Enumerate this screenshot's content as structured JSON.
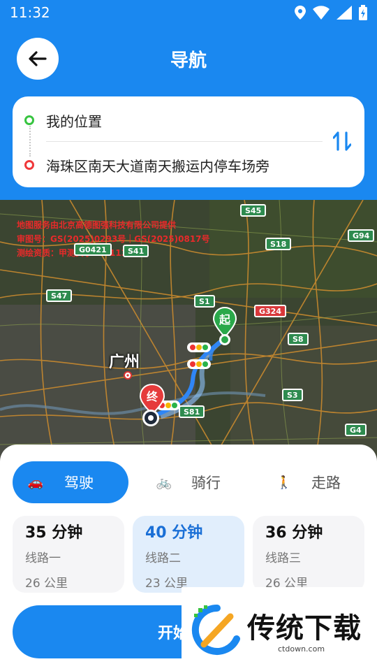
{
  "status_bar": {
    "time": "11:32"
  },
  "header": {
    "title": "导航"
  },
  "route": {
    "from": "我的位置",
    "to": "海珠区南天大道南天搬运内停车场旁"
  },
  "map": {
    "copyright_lines": [
      "地图服务由北京高德图强科技有限公司提供",
      "审图号：GS(2025)0293号｜GS(2025)0817号",
      "测绘资质：甲测资字11111328"
    ],
    "city_label": "广州",
    "start_marker": "起",
    "end_marker": "终",
    "road_badges": [
      "S45",
      "G94",
      "S18",
      "G0421",
      "S41",
      "S47",
      "S1",
      "G324",
      "S8",
      "S3",
      "S81",
      "G4"
    ]
  },
  "modes": [
    {
      "label": "驾驶",
      "icon": "🚗"
    },
    {
      "label": "骑行",
      "icon": "🚲"
    },
    {
      "label": "走路",
      "icon": "🚶"
    }
  ],
  "route_options": [
    {
      "time": "35 分钟",
      "name": "线路一",
      "distance": "26 公里"
    },
    {
      "time": "40 分钟",
      "name": "线路二",
      "distance": "23 公里"
    },
    {
      "time": "36 分钟",
      "name": "线路三",
      "distance": "26 公里"
    }
  ],
  "start_button": "开始导航",
  "watermark": {
    "text": "传统下载",
    "url": "ctdown.com"
  },
  "colors": {
    "accent": "#1a88f0",
    "start": "#37c440",
    "end": "#f0383a"
  }
}
